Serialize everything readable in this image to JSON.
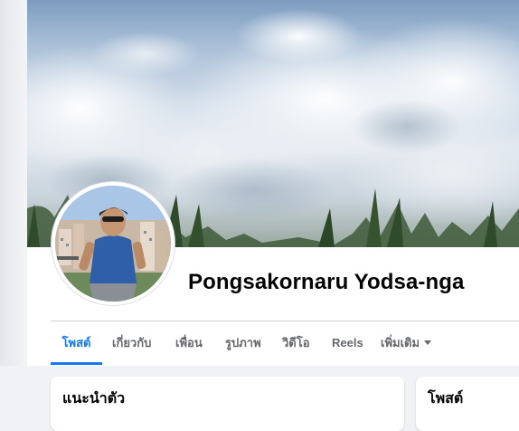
{
  "profile": {
    "name": "Pongsakornaru Yodsa-nga"
  },
  "tabs": [
    {
      "label": "โพสต์",
      "active": true
    },
    {
      "label": "เกี่ยวกับ",
      "active": false
    },
    {
      "label": "เพื่อน",
      "active": false
    },
    {
      "label": "รูปภาพ",
      "active": false
    },
    {
      "label": "วิดีโอ",
      "active": false
    },
    {
      "label": "Reels",
      "active": false
    },
    {
      "label": "เพิ่มเติม",
      "active": false,
      "icon": "caret-down-icon"
    }
  ],
  "intro_card": {
    "title": "แนะนำตัว"
  },
  "posts_card": {
    "title": "โพสต์"
  },
  "colors": {
    "accent": "#1877f2",
    "tab_inactive": "#65676b",
    "text": "#050505",
    "page_bg": "#f0f2f5"
  }
}
